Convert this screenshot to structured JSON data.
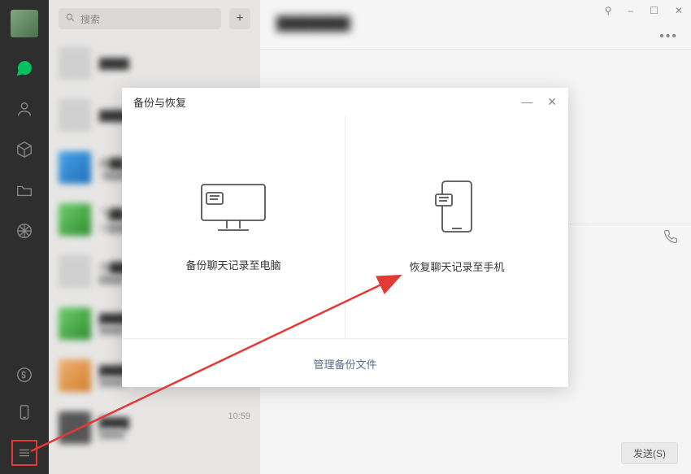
{
  "search": {
    "placeholder": "搜索"
  },
  "chatlist": {
    "items": [
      {
        "name": "████",
        "sub": "",
        "time": "",
        "thumb": "t-gray"
      },
      {
        "name": "████",
        "sub": "",
        "time": "",
        "thumb": "t-gray"
      },
      {
        "name": "闹██",
        "sub": "5████",
        "time": "",
        "thumb": "t-blue"
      },
      {
        "name": "飞██",
        "sub": "我████",
        "time": "",
        "thumb": "t-green"
      },
      {
        "name": "今████",
        "sub": "████",
        "time": "",
        "thumb": "t-gray"
      },
      {
        "name": "████",
        "sub": "████",
        "time": "",
        "thumb": "t-green"
      },
      {
        "name": "████",
        "sub": "████",
        "time": "",
        "thumb": "t-orange"
      },
      {
        "name": "████",
        "sub": "████",
        "time": "10:59",
        "thumb": "t-dark"
      }
    ]
  },
  "chat": {
    "title": "████████",
    "send_label": "发送(S)"
  },
  "win": {
    "pin": "⚲",
    "min": "–",
    "max": "☐",
    "close": "✕"
  },
  "modal": {
    "title": "备份与恢复",
    "opt_backup": "备份聊天记录至电脑",
    "opt_restore": "恢复聊天记录至手机",
    "manage": "管理备份文件"
  }
}
